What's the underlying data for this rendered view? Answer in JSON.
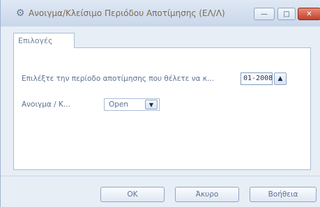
{
  "window": {
    "title": "Ανοιγμα/Κλείσιμο Περιόδου Αποτίμησης (ΕΛ/Λ)",
    "app_icon": "gear-icon",
    "controls": {
      "minimize": "—",
      "maximize": "□",
      "close": "✕"
    }
  },
  "tabs": [
    {
      "label": "Επιλογές",
      "selected": true
    }
  ],
  "form": {
    "period_label": "Επιλέξτε την περίοδο αποτίμησης που θέλετε να κ...",
    "period_value": "01-2008",
    "spin_icon": "▲",
    "open_close_label": "Ανοιγμα / Κ...",
    "open_close_value": "Open",
    "dropdown_icon": "▼"
  },
  "buttons": {
    "ok": "OK",
    "cancel": "Άκυρο",
    "help": "Βοήθεια"
  },
  "colors": {
    "accent": "#c0442c",
    "frame": "#e8eef6",
    "border": "#a9bdd6"
  }
}
